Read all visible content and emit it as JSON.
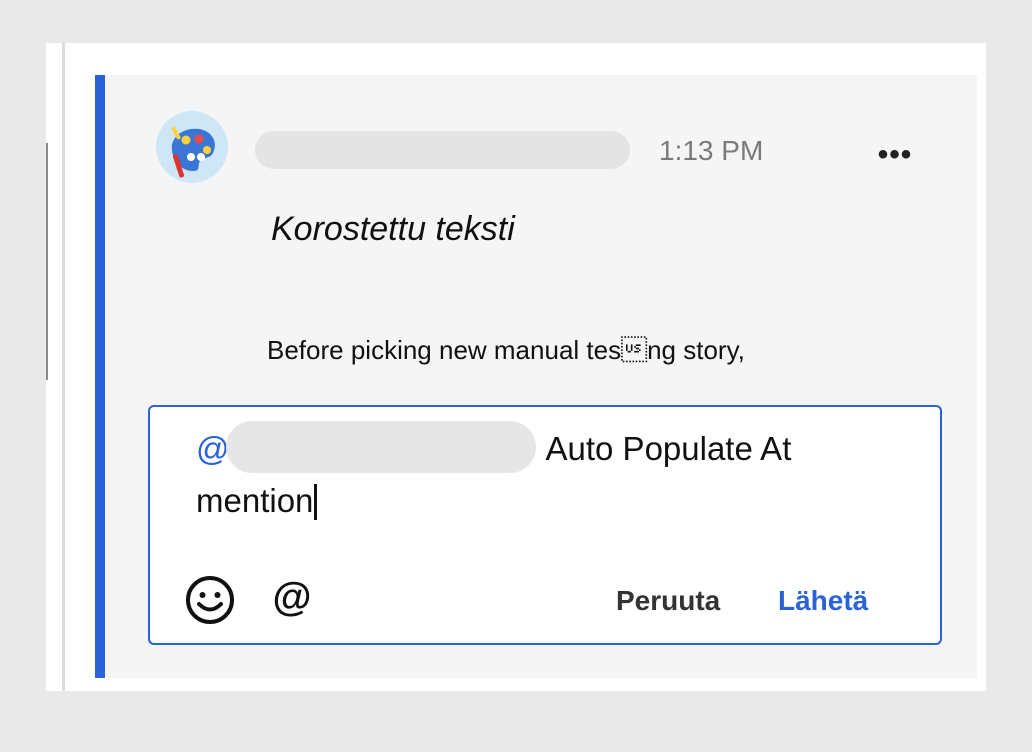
{
  "comment": {
    "time": "1:13 PM",
    "more_label": "•••",
    "highlighted_text": "Korostettu teksti",
    "body_text": "Before picking new manual tes\u001fng story,"
  },
  "reply": {
    "mention_prefix": "@",
    "text_line1": "Auto Populate At",
    "text_line2": "mention",
    "mention_icon_label": "@",
    "cancel_label": "Peruuta",
    "send_label": "Lähetä"
  },
  "colors": {
    "accent": "#2a62d8",
    "card_background": "#f5f5f5",
    "page_background": "#e9e9e9"
  },
  "icons": {
    "avatar": "palette-avatar-icon",
    "more": "more-horizontal-icon",
    "emoji": "smiley-icon",
    "mention": "at-sign-icon"
  }
}
